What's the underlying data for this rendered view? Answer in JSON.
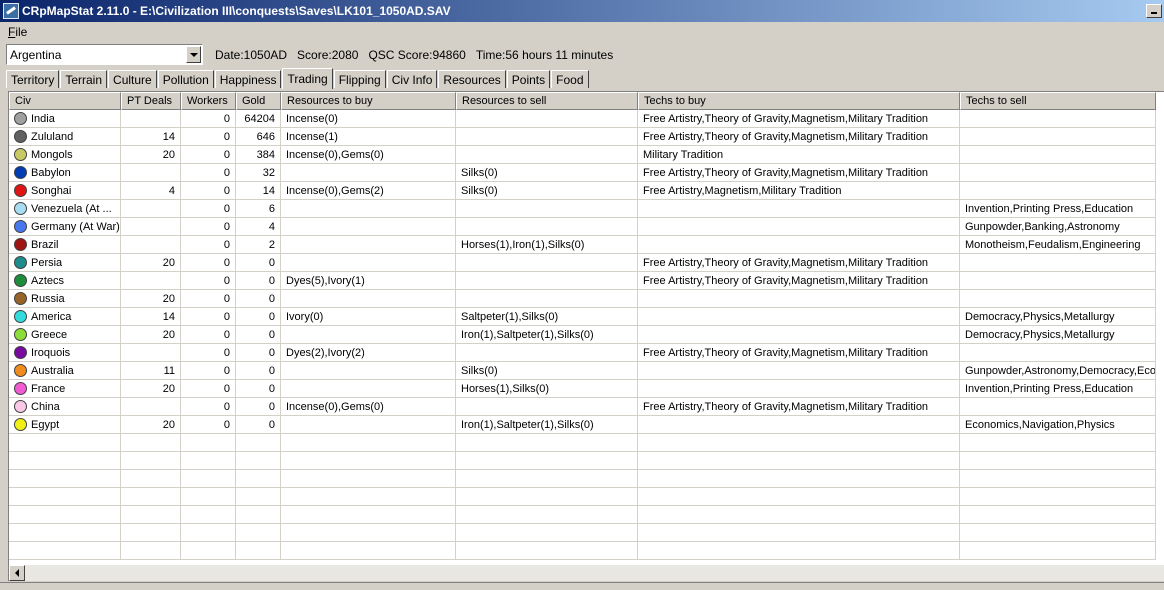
{
  "window": {
    "title": "CRpMapStat 2.11.0 - E:\\Civilization III\\conquests\\Saves\\LK101_1050AD.SAV"
  },
  "menu": {
    "file": "File"
  },
  "info": {
    "selected_civ": "Argentina",
    "date": "Date:1050AD",
    "score": "Score:2080",
    "qsc_score": "QSC Score:94860",
    "time": "Time:56 hours 11 minutes"
  },
  "tabs": [
    "Territory",
    "Terrain",
    "Culture",
    "Pollution",
    "Happiness",
    "Trading",
    "Flipping",
    "Civ Info",
    "Resources",
    "Points",
    "Food"
  ],
  "active_tab": "Trading",
  "columns": [
    "Civ",
    "PT Deals",
    "Workers",
    "Gold",
    "Resources to buy",
    "Resources to sell",
    "Techs to buy",
    "Techs to sell"
  ],
  "rows": [
    {
      "civ": "India",
      "color": "#a0a0a0",
      "pt": "",
      "workers": "0",
      "gold": "64204",
      "buy": "Incense(0)",
      "sell": "",
      "techs_buy": "Free Artistry,Theory of Gravity,Magnetism,Military Tradition",
      "techs_sell": ""
    },
    {
      "civ": "Zululand",
      "color": "#606060",
      "pt": "14",
      "workers": "0",
      "gold": "646",
      "buy": "Incense(1)",
      "sell": "",
      "techs_buy": "Free Artistry,Theory of Gravity,Magnetism,Military Tradition",
      "techs_sell": ""
    },
    {
      "civ": "Mongols",
      "color": "#c8c864",
      "pt": "20",
      "workers": "0",
      "gold": "384",
      "buy": "Incense(0),Gems(0)",
      "sell": "",
      "techs_buy": "Military Tradition",
      "techs_sell": ""
    },
    {
      "civ": "Babylon",
      "color": "#003cb4",
      "pt": "",
      "workers": "0",
      "gold": "32",
      "buy": "",
      "sell": "Silks(0)",
      "techs_buy": "Free Artistry,Theory of Gravity,Magnetism,Military Tradition",
      "techs_sell": ""
    },
    {
      "civ": "Songhai",
      "color": "#e01414",
      "pt": "4",
      "workers": "0",
      "gold": "14",
      "buy": "Incense(0),Gems(2)",
      "sell": "Silks(0)",
      "techs_buy": "Free Artistry,Magnetism,Military Tradition",
      "techs_sell": ""
    },
    {
      "civ": "Venezuela (At ...",
      "color": "#a8dcf0",
      "pt": "",
      "workers": "0",
      "gold": "6",
      "buy": "",
      "sell": "",
      "techs_buy": "",
      "techs_sell": "Invention,Printing Press,Education"
    },
    {
      "civ": "Germany (At War)",
      "color": "#4878f0",
      "pt": "",
      "workers": "0",
      "gold": "4",
      "buy": "",
      "sell": "",
      "techs_buy": "",
      "techs_sell": "Gunpowder,Banking,Astronomy"
    },
    {
      "civ": "Brazil",
      "color": "#a01414",
      "pt": "",
      "workers": "0",
      "gold": "2",
      "buy": "",
      "sell": "Horses(1),Iron(1),Silks(0)",
      "techs_buy": "",
      "techs_sell": "Monotheism,Feudalism,Engineering"
    },
    {
      "civ": "Persia",
      "color": "#1e8c8c",
      "pt": "20",
      "workers": "0",
      "gold": "0",
      "buy": "",
      "sell": "",
      "techs_buy": "Free Artistry,Theory of Gravity,Magnetism,Military Tradition",
      "techs_sell": ""
    },
    {
      "civ": "Aztecs",
      "color": "#1e8c3c",
      "pt": "",
      "workers": "0",
      "gold": "0",
      "buy": "Dyes(5),Ivory(1)",
      "sell": "",
      "techs_buy": "Free Artistry,Theory of Gravity,Magnetism,Military Tradition",
      "techs_sell": ""
    },
    {
      "civ": "Russia",
      "color": "#966428",
      "pt": "20",
      "workers": "0",
      "gold": "0",
      "buy": "",
      "sell": "",
      "techs_buy": "",
      "techs_sell": ""
    },
    {
      "civ": "America",
      "color": "#32dcdc",
      "pt": "14",
      "workers": "0",
      "gold": "0",
      "buy": "Ivory(0)",
      "sell": "Saltpeter(1),Silks(0)",
      "techs_buy": "",
      "techs_sell": "Democracy,Physics,Metallurgy"
    },
    {
      "civ": "Greece",
      "color": "#8cdc3c",
      "pt": "20",
      "workers": "0",
      "gold": "0",
      "buy": "",
      "sell": "Iron(1),Saltpeter(1),Silks(0)",
      "techs_buy": "",
      "techs_sell": "Democracy,Physics,Metallurgy"
    },
    {
      "civ": "Iroquois",
      "color": "#780aa0",
      "pt": "",
      "workers": "0",
      "gold": "0",
      "buy": "Dyes(2),Ivory(2)",
      "sell": "",
      "techs_buy": "Free Artistry,Theory of Gravity,Magnetism,Military Tradition",
      "techs_sell": ""
    },
    {
      "civ": "Australia",
      "color": "#f08c1e",
      "pt": "11",
      "workers": "0",
      "gold": "0",
      "buy": "",
      "sell": "Silks(0)",
      "techs_buy": "",
      "techs_sell": "Gunpowder,Astronomy,Democracy,Economics"
    },
    {
      "civ": "France",
      "color": "#f05ad2",
      "pt": "20",
      "workers": "0",
      "gold": "0",
      "buy": "",
      "sell": "Horses(1),Silks(0)",
      "techs_buy": "",
      "techs_sell": "Invention,Printing Press,Education"
    },
    {
      "civ": "China",
      "color": "#f8c8e6",
      "pt": "",
      "workers": "0",
      "gold": "0",
      "buy": "Incense(0),Gems(0)",
      "sell": "",
      "techs_buy": "Free Artistry,Theory of Gravity,Magnetism,Military Tradition",
      "techs_sell": ""
    },
    {
      "civ": "Egypt",
      "color": "#f0f014",
      "pt": "20",
      "workers": "0",
      "gold": "0",
      "buy": "",
      "sell": "Iron(1),Saltpeter(1),Silks(0)",
      "techs_buy": "",
      "techs_sell": "Economics,Navigation,Physics"
    }
  ],
  "empty_rows": 7
}
